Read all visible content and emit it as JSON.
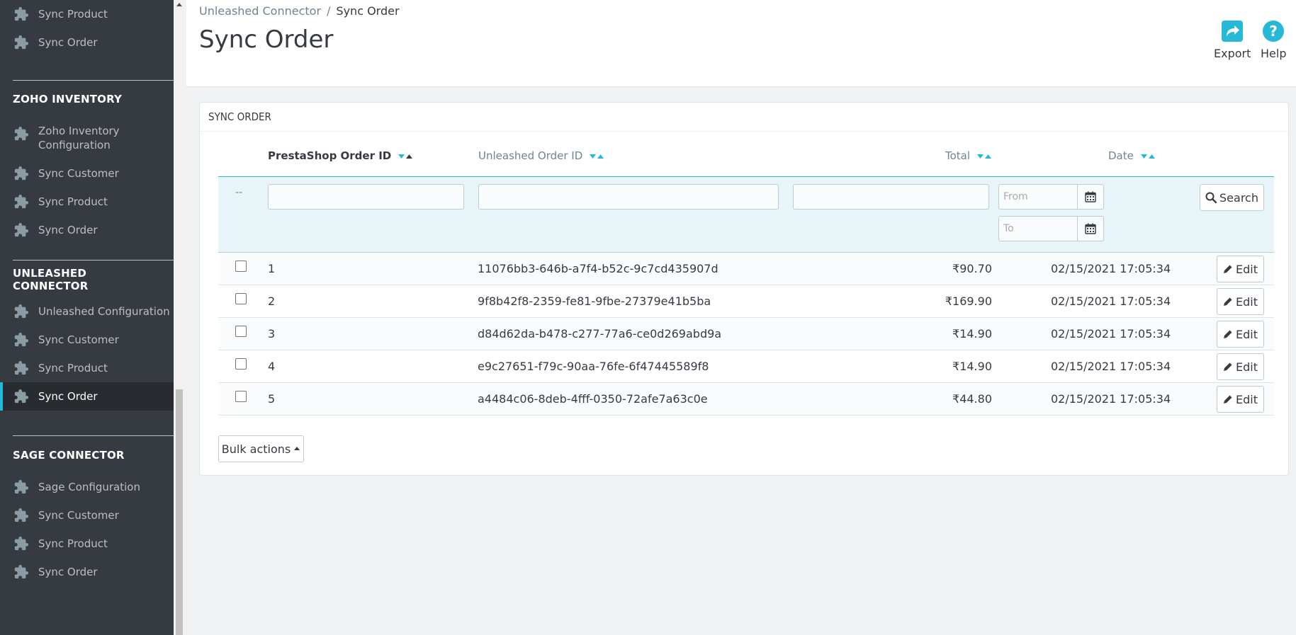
{
  "sidebar": {
    "top_items": [
      "Sync Product",
      "Sync Order"
    ],
    "sections": [
      {
        "title": "ZOHO INVENTORY",
        "items": [
          "Zoho Inventory Configuration",
          "Sync Customer",
          "Sync Product",
          "Sync Order"
        ]
      },
      {
        "title": "UNLEASHED CONNECTOR",
        "items": [
          "Unleashed Configuration",
          "Sync Customer",
          "Sync Product",
          "Sync Order"
        ]
      },
      {
        "title": "SAGE CONNECTOR",
        "items": [
          "Sage Configuration",
          "Sync Customer",
          "Sync Product",
          "Sync Order"
        ]
      }
    ],
    "active": "UNLEASHED CONNECTOR / Sync Order"
  },
  "header": {
    "breadcrumb_parent": "Unleashed Connector",
    "breadcrumb_sep": "/",
    "breadcrumb_current": "Sync Order",
    "title": "Sync Order",
    "export_label": "Export",
    "help_label": "Help"
  },
  "panel": {
    "heading": "SYNC ORDER",
    "columns": {
      "prestashop_id": "PrestaShop Order ID",
      "unleashed_id": "Unleashed Order ID",
      "total": "Total",
      "date": "Date"
    },
    "filter": {
      "dash": "--",
      "from_placeholder": "From",
      "to_placeholder": "To",
      "search_label": "Search"
    },
    "rows": [
      {
        "id": "1",
        "unleashed_id": "11076bb3-646b-a7f4-b52c-9c7cd435907d",
        "total": "₹90.70",
        "date": "02/15/2021 17:05:34"
      },
      {
        "id": "2",
        "unleashed_id": "9f8b42f8-2359-fe81-9fbe-27379e41b5ba",
        "total": "₹169.90",
        "date": "02/15/2021 17:05:34"
      },
      {
        "id": "3",
        "unleashed_id": "d84d62da-b478-c277-77a6-ce0d269abd9a",
        "total": "₹14.90",
        "date": "02/15/2021 17:05:34"
      },
      {
        "id": "4",
        "unleashed_id": "e9c27651-f79c-90aa-76fe-6f47445589f8",
        "total": "₹14.90",
        "date": "02/15/2021 17:05:34"
      },
      {
        "id": "5",
        "unleashed_id": "a4484c06-8deb-4fff-0350-72afe7a63c0e",
        "total": "₹44.80",
        "date": "02/15/2021 17:05:34"
      }
    ],
    "edit_label": "Edit",
    "bulk_actions_label": "Bulk actions"
  },
  "colors": {
    "accent": "#25b9d7",
    "sidebar_bg": "#363a41",
    "active_bg": "#282b30"
  }
}
